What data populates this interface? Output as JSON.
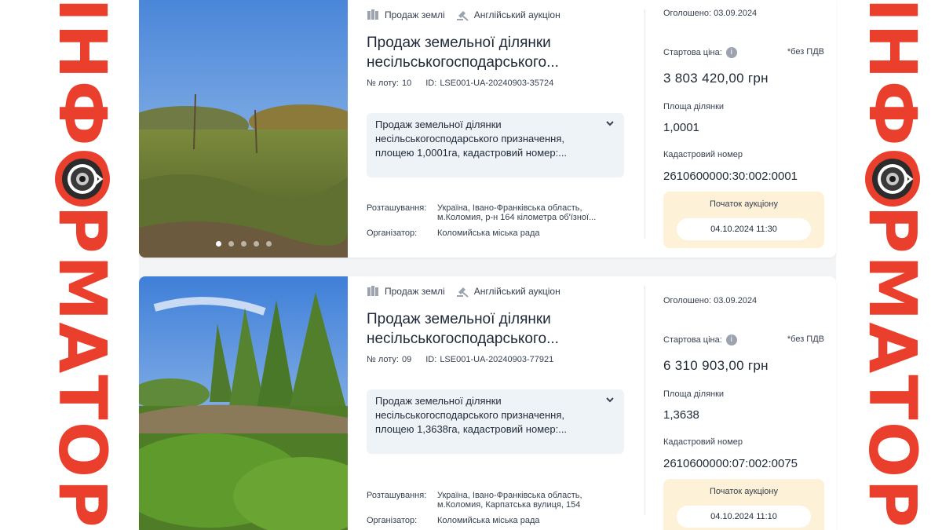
{
  "watermark": {
    "text": "ІНФОРМАТОР",
    "brand_color": "#ea3f2c"
  },
  "listings": [
    {
      "tags": {
        "sale_type": "Продаж землі",
        "auction_type": "Англійський аукціон"
      },
      "title": "Продаж земельної ділянки несільськогосподарського...",
      "lot_label": "№ лоту:",
      "lot_number": "10",
      "id_label": "ID:",
      "id_value": "LSE001-UA-20240903-35724",
      "description": "Продаж земельної ділянки несільськогосподарського призначення, площею 1,0001га, кадастровий номер:...",
      "location_label": "Розташування:",
      "location_value": "Україна, Івано-Франківська область, м.Коломия, р-н 164 кілометра об'їзної...",
      "organizer_label": "Організатор:",
      "organizer_value": "Коломийська міська рада",
      "announced_label": "Оголошено:",
      "announced_date": "03.09.2024",
      "start_price_label": "Стартова ціна:",
      "vat_note": "*без ПДВ",
      "price": "3 803 420,00 грн",
      "area_label": "Площа ділянки",
      "area_value": "1,0001",
      "cadastral_label": "Кадастровий номер",
      "cadastral_value": "2610600000:30:002:0001",
      "auction_start_label": "Початок аукціону",
      "auction_start_value": "04.10.2024 11:30",
      "photo_count": 5,
      "active_photo": 1
    },
    {
      "tags": {
        "sale_type": "Продаж землі",
        "auction_type": "Англійський аукціон"
      },
      "title": "Продаж земельної ділянки несільськогосподарського...",
      "lot_label": "№ лоту:",
      "lot_number": "09",
      "id_label": "ID:",
      "id_value": "LSE001-UA-20240903-77921",
      "description": "Продаж земельної ділянки несільськогосподарського призначення, площею 1,3638га, кадастровий номер:...",
      "location_label": "Розташування:",
      "location_value": "Україна, Івано-Франківська область, м.Коломия, Карпатська вулиця, 154",
      "organizer_label": "Організатор:",
      "organizer_value": "Коломийська міська рада",
      "announced_label": "Оголошено:",
      "announced_date": "03.09.2024",
      "start_price_label": "Стартова ціна:",
      "vat_note": "*без ПДВ",
      "price": "6 310 903,00 грн",
      "area_label": "Площа ділянки",
      "area_value": "1,3638",
      "cadastral_label": "Кадастровий номер",
      "cadastral_value": "2610600000:07:002:0075",
      "auction_start_label": "Початок аукціону",
      "auction_start_value": "04.10.2024 11:10"
    }
  ],
  "colors": {
    "desc_box": "#eef3f8",
    "auction_box": "#fdf1d8",
    "page_bg": "#f3f4f6"
  }
}
